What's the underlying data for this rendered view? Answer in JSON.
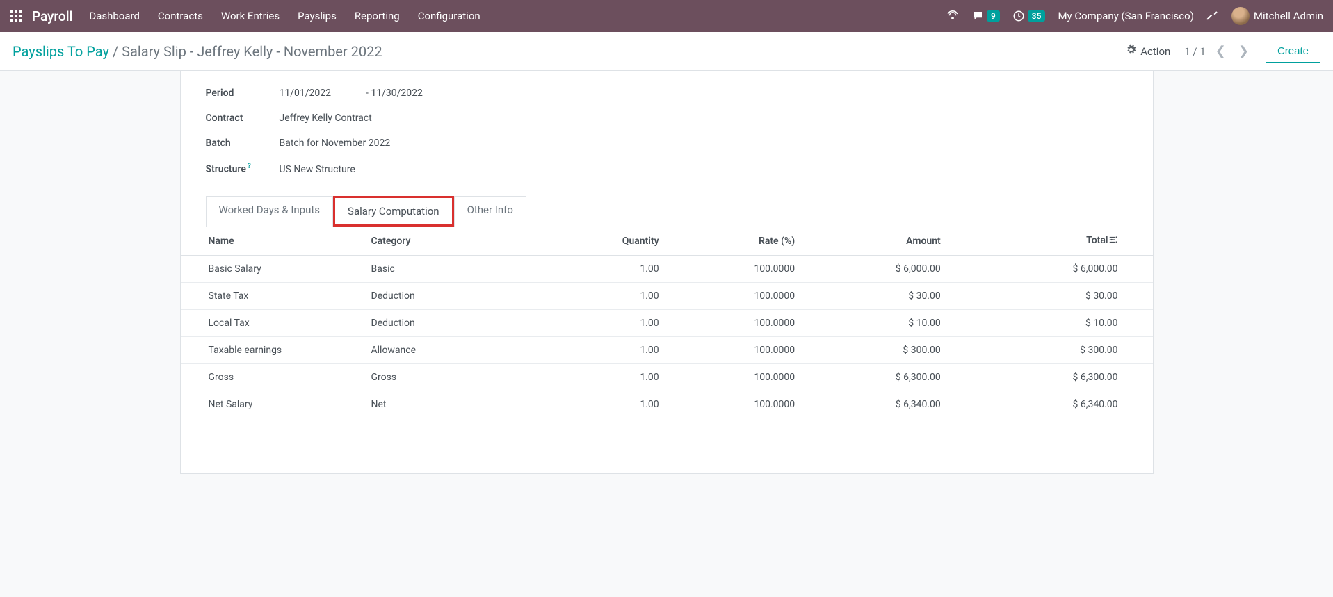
{
  "header": {
    "app_name": "Payroll",
    "menu": [
      "Dashboard",
      "Contracts",
      "Work Entries",
      "Payslips",
      "Reporting",
      "Configuration"
    ],
    "chat_count": "9",
    "clock_count": "35",
    "company": "My Company (San Francisco)",
    "user": "Mitchell Admin"
  },
  "breadcrumb": {
    "root": "Payslips To Pay",
    "sep": " / ",
    "current": "Salary Slip - Jeffrey Kelly - November 2022"
  },
  "controls": {
    "action": "Action",
    "page": "1 / 1",
    "create": "Create"
  },
  "fields": {
    "period_label": "Period",
    "period_from": "11/01/2022",
    "period_to": "- 11/30/2022",
    "contract_label": "Contract",
    "contract_value": "Jeffrey Kelly Contract",
    "batch_label": "Batch",
    "batch_value": "Batch for November 2022",
    "structure_label": "Structure",
    "structure_value": "US New Structure"
  },
  "tabs": {
    "t1": "Worked Days & Inputs",
    "t2": "Salary Computation",
    "t3": "Other Info"
  },
  "table": {
    "cols": {
      "name": "Name",
      "category": "Category",
      "quantity": "Quantity",
      "rate": "Rate (%)",
      "amount": "Amount",
      "total": "Total"
    },
    "rows": [
      {
        "name": "Basic Salary",
        "category": "Basic",
        "quantity": "1.00",
        "rate": "100.0000",
        "amount": "$ 6,000.00",
        "total": "$ 6,000.00"
      },
      {
        "name": "State Tax",
        "category": "Deduction",
        "quantity": "1.00",
        "rate": "100.0000",
        "amount": "$ 30.00",
        "total": "$ 30.00"
      },
      {
        "name": "Local Tax",
        "category": "Deduction",
        "quantity": "1.00",
        "rate": "100.0000",
        "amount": "$ 10.00",
        "total": "$ 10.00"
      },
      {
        "name": "Taxable earnings",
        "category": "Allowance",
        "quantity": "1.00",
        "rate": "100.0000",
        "amount": "$ 300.00",
        "total": "$ 300.00"
      },
      {
        "name": "Gross",
        "category": "Gross",
        "quantity": "1.00",
        "rate": "100.0000",
        "amount": "$ 6,300.00",
        "total": "$ 6,300.00"
      },
      {
        "name": "Net Salary",
        "category": "Net",
        "quantity": "1.00",
        "rate": "100.0000",
        "amount": "$ 6,340.00",
        "total": "$ 6,340.00"
      }
    ]
  }
}
